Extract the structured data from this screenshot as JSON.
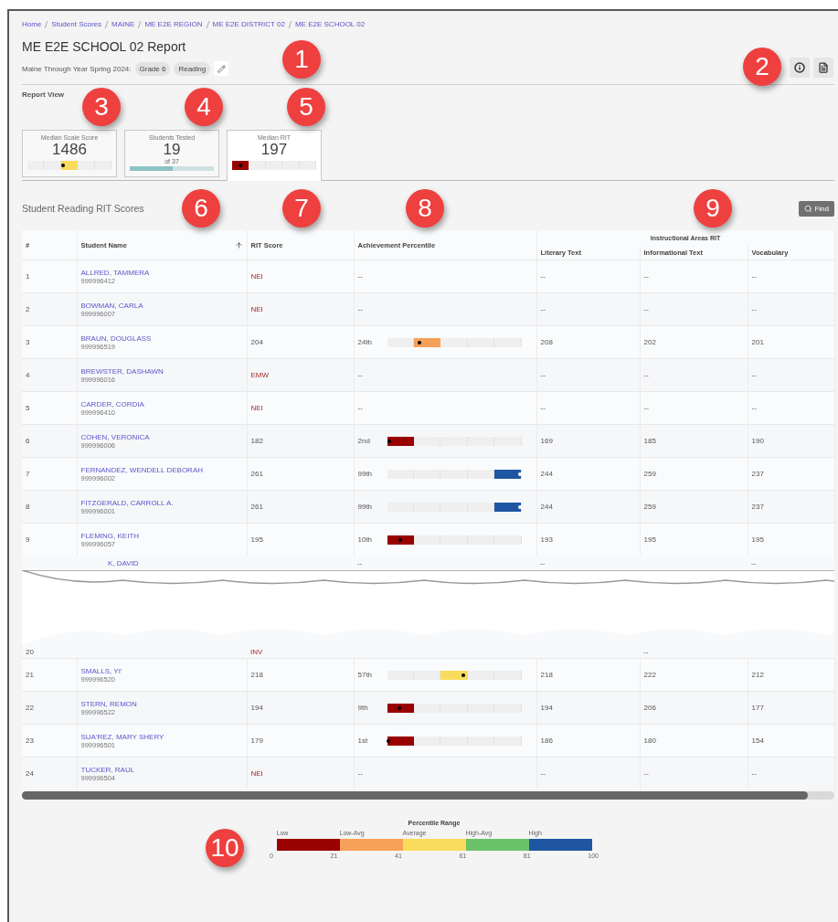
{
  "breadcrumbs": [
    {
      "label": "Home"
    },
    {
      "label": "Student Scores"
    },
    {
      "label": "MAINE"
    },
    {
      "label": "ME E2E REGION"
    },
    {
      "label": "ME E2E DISTRICT 02"
    },
    {
      "label": "ME E2E SCHOOL 02"
    }
  ],
  "title": "ME E2E SCHOOL 02 Report",
  "filter": {
    "label": "Maine Through Year Spring 2024:",
    "chips": [
      "Grade 6",
      "Reading"
    ]
  },
  "report_view": {
    "label": "Report View",
    "cards": [
      {
        "kind": "percentile",
        "title": "Median Scale Score",
        "value": "1486",
        "level": 0.42,
        "selected": false
      },
      {
        "kind": "progress",
        "title": "Students Tested",
        "value": "19",
        "sub": "of 37",
        "level": 0.51,
        "selected": false
      },
      {
        "kind": "percentile",
        "title": "Median RIT",
        "value": "197",
        "level": 0.1,
        "selected": true
      }
    ]
  },
  "table": {
    "title": "Student Reading RIT Scores",
    "find_button": "Find",
    "group_header": "Instructional Areas RIT",
    "columns": [
      {
        "label": "#",
        "sorted": false
      },
      {
        "label": "Student Name",
        "sorted": true
      },
      {
        "label": "RIT Score",
        "sorted": false
      },
      {
        "label": "Achievement Percentile",
        "sorted": false
      },
      {
        "label": "Literary Text"
      },
      {
        "label": "Informational Text"
      },
      {
        "label": "Vocabulary"
      }
    ],
    "rows": [
      {
        "num": "1",
        "name": "ALLRED, TAMMERA",
        "id": "999996412",
        "rit": "NEI",
        "flagged": true,
        "percentile": "--",
        "areas": [
          "--",
          "--",
          "--"
        ]
      },
      {
        "num": "2",
        "name": "BOWMAN, CARLA",
        "id": "999996007",
        "rit": "NEI",
        "flagged": true,
        "percentile": "--",
        "areas": [
          "--",
          "--",
          "--"
        ]
      },
      {
        "num": "3",
        "name": "BRAUN, DOUGLASS",
        "id": "999996519",
        "rit": "204",
        "flagged": false,
        "percentile": "24th",
        "level": 0.24,
        "areas": [
          "208",
          "202",
          "201"
        ]
      },
      {
        "num": "4",
        "name": "BREWSTER, DASHAWN",
        "id": "999996016",
        "rit": "EMW",
        "flagged": true,
        "percentile": "--",
        "areas": [
          "--",
          "--",
          "--"
        ]
      },
      {
        "num": "5",
        "name": "CARDER, CORDIA",
        "id": "999996410",
        "rit": "NEI",
        "flagged": true,
        "percentile": "--",
        "areas": [
          "--",
          "--",
          "--"
        ]
      },
      {
        "num": "6",
        "name": "COHEN, VERONICA",
        "id": "999996006",
        "rit": "182",
        "flagged": false,
        "percentile": "2nd",
        "level": 0.02,
        "areas": [
          "169",
          "185",
          "190"
        ]
      },
      {
        "num": "7",
        "name": "FERNANDEZ, WENDELL DEBORAH",
        "id": "999996002",
        "rit": "261",
        "flagged": false,
        "percentile": "99th",
        "level": 0.99,
        "areas": [
          "244",
          "259",
          "237"
        ]
      },
      {
        "num": "8",
        "name": "FITZGERALD, CARROLL A.",
        "id": "999996001",
        "rit": "261",
        "flagged": false,
        "percentile": "99th",
        "level": 0.99,
        "areas": [
          "244",
          "259",
          "237"
        ]
      },
      {
        "num": "9",
        "name": "FLEMING, KEITH",
        "id": "999996057",
        "rit": "195",
        "flagged": false,
        "percentile": "10th",
        "level": 0.1,
        "areas": [
          "193",
          "195",
          "195"
        ]
      },
      {
        "kind": "gap",
        "above": {
          "name": "K, DAVID",
          "percentile": "--",
          "literary": "--",
          "vocabulary": "--"
        },
        "below": {
          "num": "20",
          "rit": "INV",
          "informational": "--"
        }
      },
      {
        "num": "21",
        "name": "SMALLS, YI'",
        "id": "999996520",
        "rit": "218",
        "flagged": false,
        "percentile": "57th",
        "level": 0.57,
        "areas": [
          "218",
          "222",
          "212"
        ]
      },
      {
        "num": "22",
        "name": "STERN, REMON",
        "id": "999996522",
        "rit": "194",
        "flagged": false,
        "percentile": "9th",
        "level": 0.09,
        "areas": [
          "194",
          "206",
          "177"
        ]
      },
      {
        "num": "23",
        "name": "SUA'REZ, MARY SHERY",
        "id": "999996501",
        "rit": "179",
        "flagged": false,
        "percentile": "1st",
        "level": 0.01,
        "areas": [
          "186",
          "180",
          "154"
        ]
      },
      {
        "num": "24",
        "name": "TUCKER, RAUL",
        "id": "999996504",
        "rit": "NEI",
        "flagged": true,
        "percentile": "--",
        "areas": [
          "--",
          "--",
          "--"
        ]
      }
    ]
  },
  "legend": {
    "title": "Percentile Range",
    "bands": [
      {
        "label": "Low",
        "color": "#990000"
      },
      {
        "label": "Low-Avg",
        "color": "#f7a05a"
      },
      {
        "label": "Average",
        "color": "#f9dc5c"
      },
      {
        "label": "High-Avg",
        "color": "#6cc26a"
      },
      {
        "label": "High",
        "color": "#1f56a3"
      }
    ],
    "ticks": [
      "0",
      "21",
      "41",
      "61",
      "81",
      "100"
    ]
  },
  "callouts": [
    {
      "label": "1"
    },
    {
      "label": "2"
    },
    {
      "label": "3"
    },
    {
      "label": "4"
    },
    {
      "label": "5"
    },
    {
      "label": "6"
    },
    {
      "label": "7"
    },
    {
      "label": "8"
    },
    {
      "label": "9"
    },
    {
      "label": "10"
    }
  ]
}
